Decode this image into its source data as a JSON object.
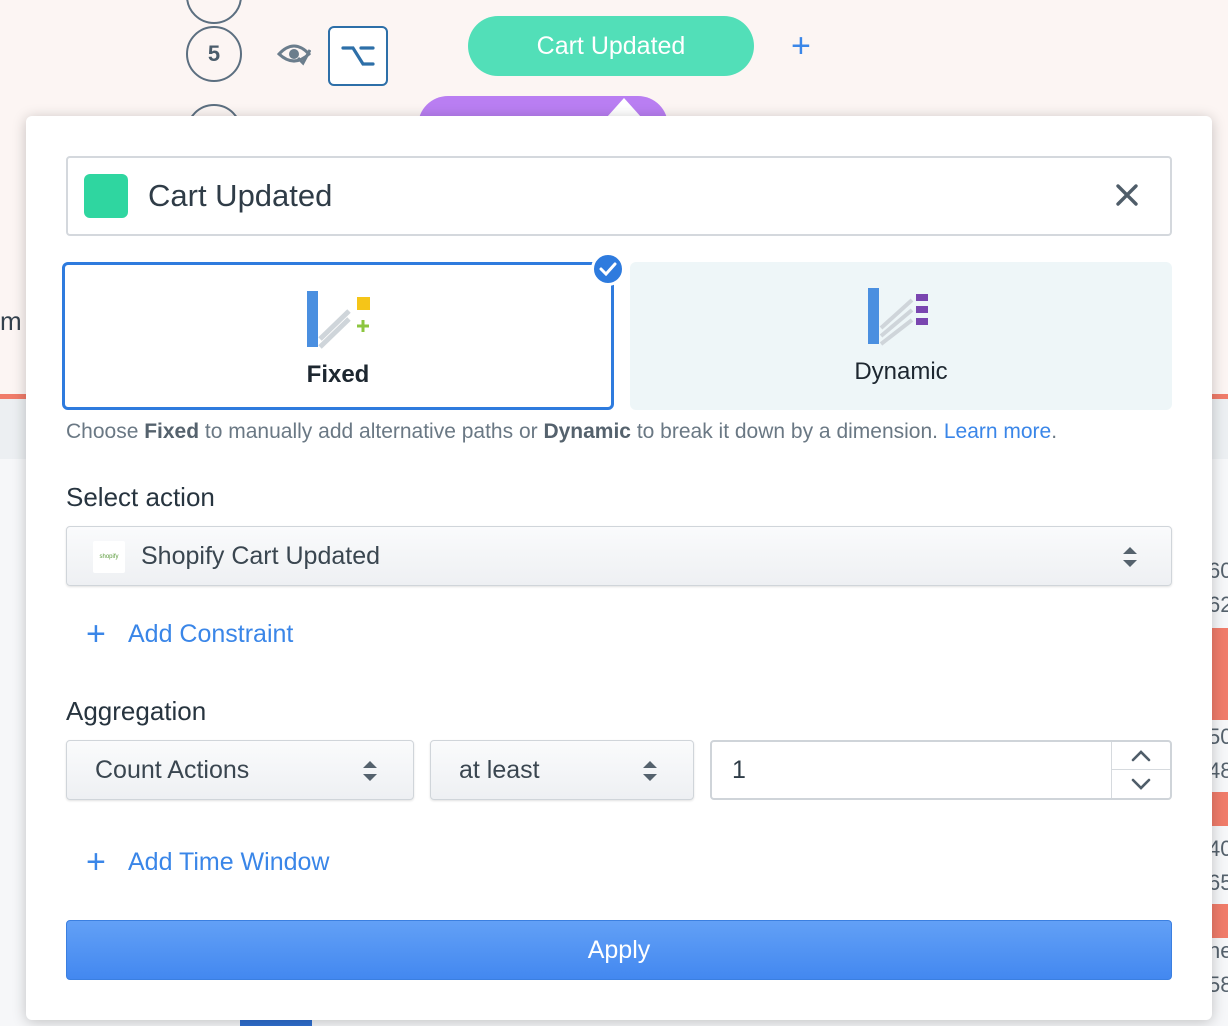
{
  "background": {
    "steps": [
      "5"
    ],
    "step_pill_label": "Cart Updated",
    "add_step_symbol": "+",
    "side_fragment": "m",
    "right_fragments": [
      "60",
      "62",
      "50",
      "48",
      "40",
      "65",
      "he",
      "58"
    ]
  },
  "popup": {
    "step_name": "Cart Updated",
    "swatch_color": "#2fd6a0",
    "close_icon": "close-icon",
    "modes": [
      {
        "label": "Fixed",
        "selected": true
      },
      {
        "label": "Dynamic",
        "selected": false
      }
    ],
    "help": {
      "prefix": "Choose ",
      "fixed": "Fixed",
      "middle": " to manually add alternative paths or ",
      "dynamic": "Dynamic",
      "suffix": " to break it down by a dimension. ",
      "link": "Learn more",
      "end": "."
    },
    "select_action_label": "Select action",
    "action_logo_text": "shopify",
    "action_value": "Shopify Cart Updated",
    "add_constraint": "Add Constraint",
    "aggregation_label": "Aggregation",
    "aggregation_type": "Count Actions",
    "comparator": "at least",
    "count_value": "1",
    "add_time_window": "Add Time Window",
    "apply_label": "Apply",
    "accent_color": "#2e7bde",
    "link_color": "#3a86e8"
  }
}
